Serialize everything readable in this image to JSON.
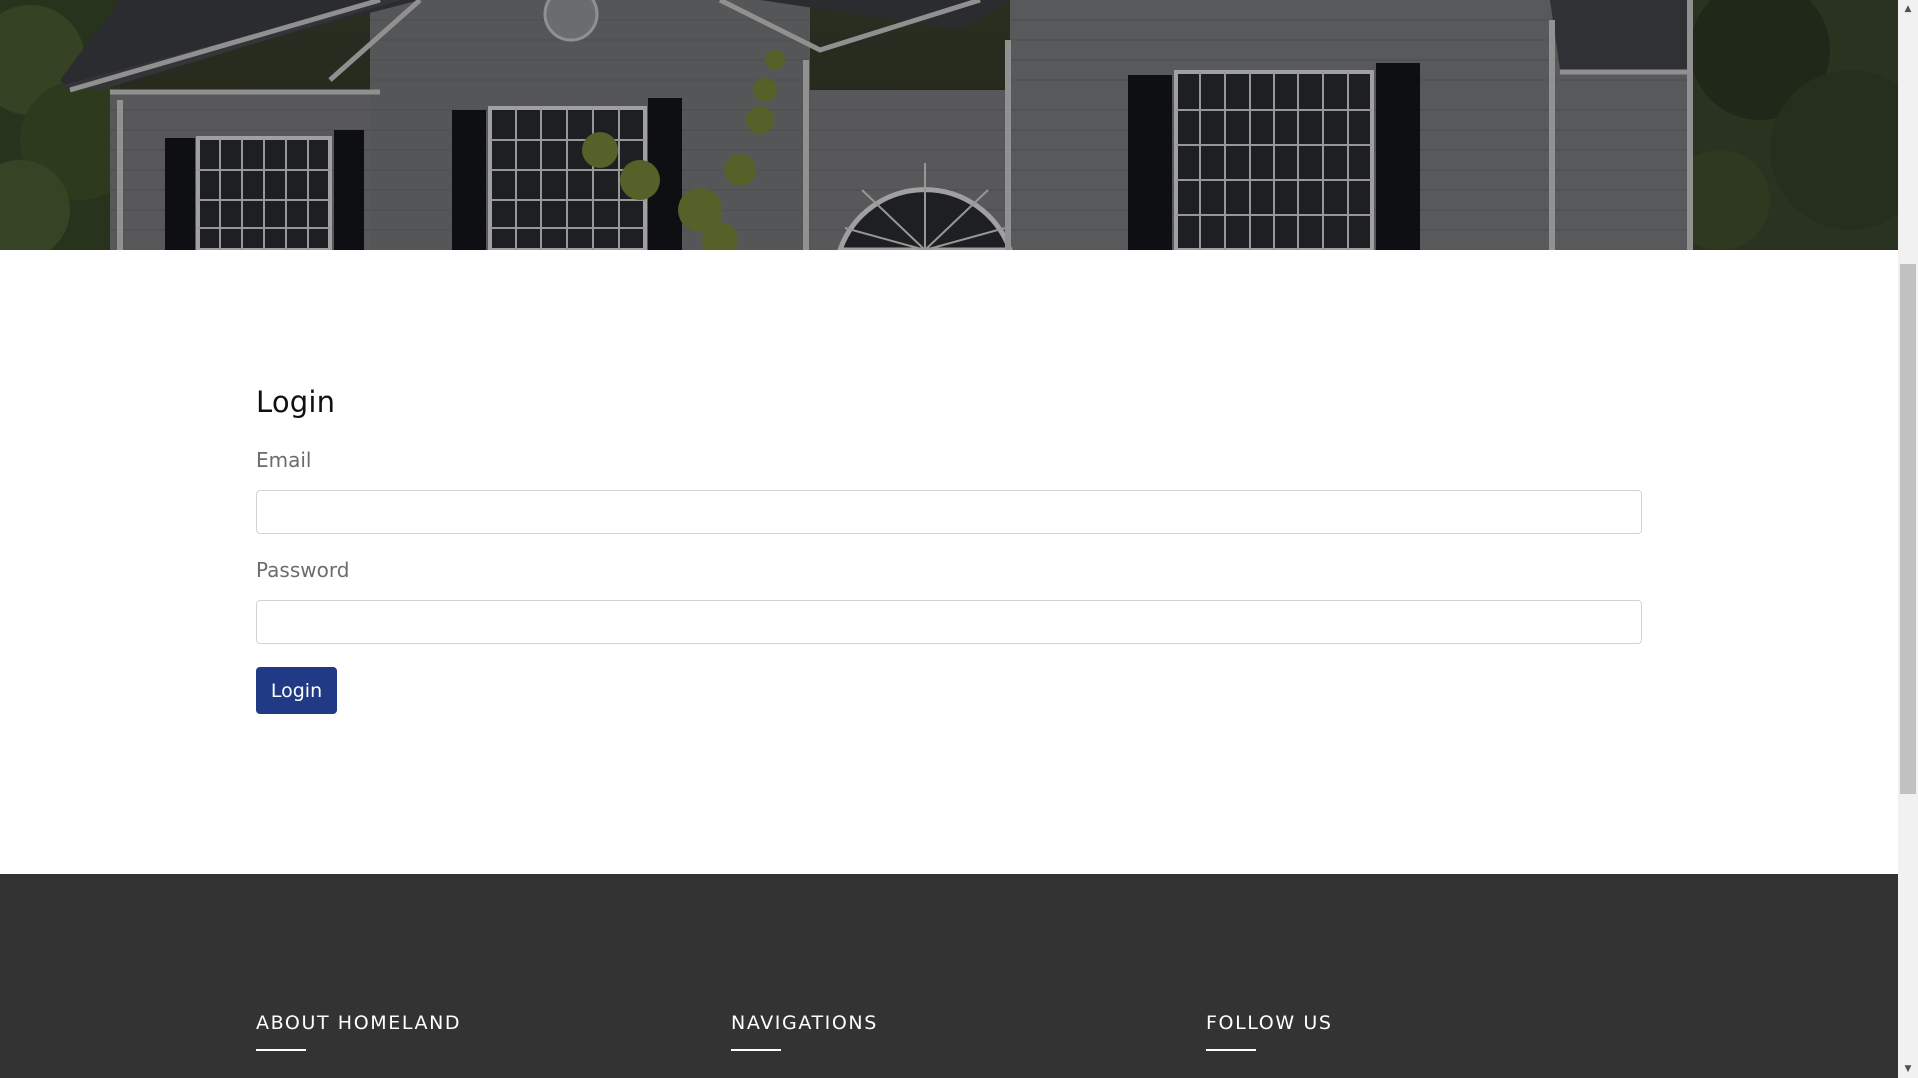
{
  "hero": {
    "image": "house-exterior-photo"
  },
  "login": {
    "title": "Login",
    "email_label": "Email",
    "email_value": "",
    "password_label": "Password",
    "password_value": "",
    "submit_label": "Login",
    "button_color": "#213a85"
  },
  "footer": {
    "background_color": "#333333",
    "columns": [
      {
        "heading": "ABOUT HOMELAND"
      },
      {
        "heading": "NAVIGATIONS"
      },
      {
        "heading": "FOLLOW US"
      }
    ]
  },
  "scrollbar": {
    "up_icon": "scroll-up-arrow",
    "down_icon": "scroll-down-arrow"
  }
}
